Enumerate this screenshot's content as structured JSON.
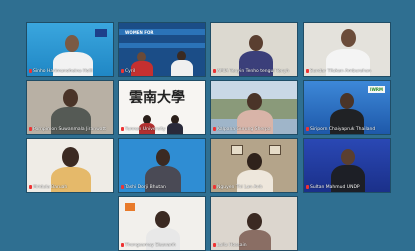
{
  "meeting": {
    "participants": [
      {
        "name": "Sinho Harimanoheina Holli"
      },
      {
        "name": "Cyril"
      },
      {
        "name": "AMIA Tenyin Tenho tengul Tenyh"
      },
      {
        "name": "Sundar Tilakan Amburahan"
      },
      {
        "name": "Pornpimon Suwanmala Jiranwatt"
      },
      {
        "name": "Yunnan University"
      },
      {
        "name": "Kalpana Gurung Sherpa"
      },
      {
        "name": "Siriporn Chaiyapruk Thailand"
      },
      {
        "name": "Mridula Baruah"
      },
      {
        "name": "Tashi Dorji Bhutan"
      },
      {
        "name": "Nguyen Thi Lan Anh"
      },
      {
        "name": "Sultan Mahmud UNDP"
      },
      {
        "name": "Thongsamay Sisavanh"
      },
      {
        "name": "Laila Hossain"
      }
    ],
    "banner_text": "WOMEN FOR",
    "uni_text": "雲南大學",
    "tag_text": "IWRM"
  }
}
